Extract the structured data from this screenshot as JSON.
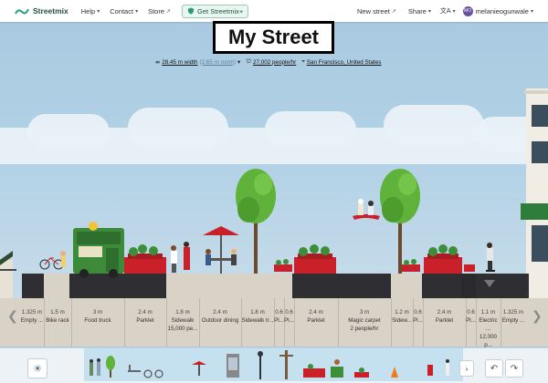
{
  "app": {
    "brand": "Streetmix",
    "nav": [
      {
        "label": "Help",
        "chevron": "▾"
      },
      {
        "label": "Contact",
        "chevron": "▾"
      },
      {
        "label": "Store",
        "chevron": "↗"
      }
    ],
    "get_button": "Get Streetmix+",
    "new_street": "New street",
    "share": "Share",
    "translate_icon": "translate-icon",
    "username": "melanieogunwale",
    "avatar_initials": "MO"
  },
  "street": {
    "title": "My Street",
    "width_label": "28.45 m width",
    "room_label": "(2.65 m room)",
    "capacity": "27,002 people/hr",
    "location": "San Francisco, United States"
  },
  "segments": [
    {
      "width": "1.325 m",
      "name": "Empty ..."
    },
    {
      "width": "1.5 m",
      "name": "Bike rack"
    },
    {
      "width": "3 m",
      "name": "Food truck"
    },
    {
      "width": "2.4 m",
      "name": "Parklet"
    },
    {
      "width": "1.8 m",
      "name": "Sidewalk",
      "extra": "15,000 pe..."
    },
    {
      "width": "2.4 m",
      "name": "Outdoor dining"
    },
    {
      "width": "1.8 m",
      "name": "Sidewalk tr..."
    },
    {
      "width": "0.6",
      "name": "Pl..."
    },
    {
      "width": "0.6",
      "name": "Pl..."
    },
    {
      "width": "2.4 m",
      "name": "Parklet"
    },
    {
      "width": "3 m",
      "name": "Magic carpet",
      "extra": "2 people/hr"
    },
    {
      "width": "1.2 m",
      "name": "Sidew..."
    },
    {
      "width": "0.6",
      "name": "Pl..."
    },
    {
      "width": "2.4 m",
      "name": "Parklet"
    },
    {
      "width": "0.6",
      "name": "Pl..."
    },
    {
      "width": "1.1 m",
      "name": "Electric ...",
      "extra": "12,000 p..."
    },
    {
      "width": "1.325 m",
      "name": "Empty ..."
    }
  ],
  "controls": {
    "scroll_left_icon": "chevron-left-icon",
    "scroll_right_icon": "chevron-right-icon",
    "sun_icon": "sun-icon",
    "palette_next": "›",
    "undo_icon": "undo-icon",
    "redo_icon": "redo-icon"
  },
  "colors": {
    "asphalt": "#2f2f33",
    "parklet": "#c9202a",
    "food_truck": "#3d8a3a",
    "tree": "#5fb33a",
    "sky": "#a9cbe2",
    "sidewalk": "#d9d2c6"
  }
}
